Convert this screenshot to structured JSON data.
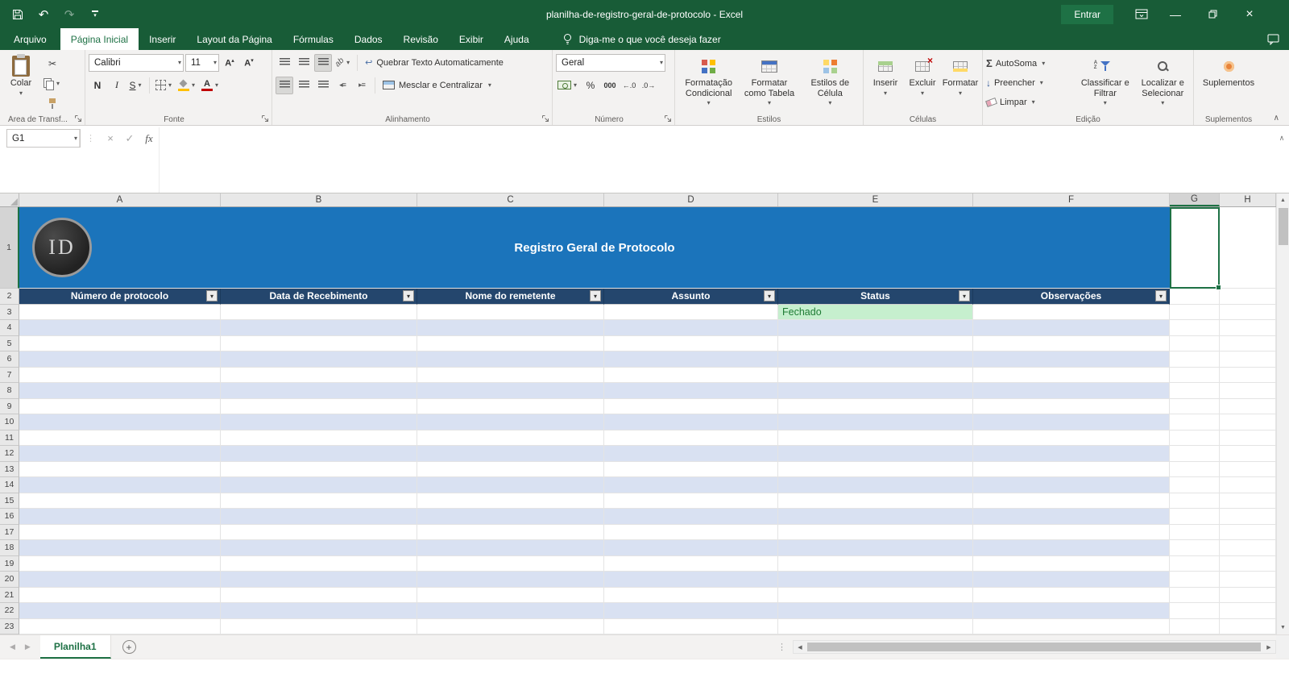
{
  "colors": {
    "excel_green": "#185C37",
    "accent_green": "#1E7145",
    "banner_blue": "#1B74BB",
    "table_header_blue": "#24466D",
    "band_blue": "#D9E1F2",
    "status_bg": "#C6EFCE",
    "status_text": "#1E7B34"
  },
  "titlebar": {
    "title": "planilha-de-registro-geral-de-protocolo - Excel",
    "signin": "Entrar"
  },
  "ribbon_tabs": {
    "file": "Arquivo",
    "tabs": [
      "Página Inicial",
      "Inserir",
      "Layout da Página",
      "Fórmulas",
      "Dados",
      "Revisão",
      "Exibir",
      "Ajuda"
    ],
    "tellme": "Diga-me o que você deseja fazer"
  },
  "ribbon": {
    "clipboard": {
      "paste": "Colar",
      "label": "Área de Transf..."
    },
    "font": {
      "name": "Calibri",
      "size": "11",
      "bold": "N",
      "italic": "I",
      "underline": "S",
      "label": "Fonte"
    },
    "alignment": {
      "wrap": "Quebrar Texto Automaticamente",
      "merge": "Mesclar e Centralizar",
      "label": "Alinhamento"
    },
    "number": {
      "format": "Geral",
      "percent": "%",
      "thousands": "000",
      "label": "Número"
    },
    "styles": {
      "conditional": "Formatação Condicional",
      "table": "Formatar como Tabela",
      "cell": "Estilos de Célula",
      "label": "Estilos"
    },
    "cells": {
      "insert": "Inserir",
      "delete": "Excluir",
      "format": "Formatar",
      "label": "Células"
    },
    "editing": {
      "autosum": "AutoSoma",
      "fill": "Preencher",
      "clear": "Limpar",
      "sort": "Classificar e Filtrar",
      "find": "Localizar e Selecionar",
      "label": "Edição"
    },
    "addins": {
      "button": "Suplementos",
      "label": "Suplementos"
    }
  },
  "formula_bar": {
    "name_box": "G1",
    "fx": "fx",
    "value": ""
  },
  "sheet": {
    "column_letters": [
      "A",
      "B",
      "C",
      "D",
      "E",
      "F",
      "G",
      "H"
    ],
    "row_numbers": [
      1,
      2,
      3,
      4,
      5,
      6,
      7,
      8,
      9,
      10,
      11,
      12,
      13,
      14,
      15,
      16,
      17,
      18,
      19,
      20,
      21,
      22,
      23
    ],
    "selected_cell": "G1",
    "banner_title": "Registro Geral de Protocolo",
    "logo_text": "ID",
    "table_headers": [
      "Número de protocolo",
      "Data de Recebimento",
      "Nome do remetente",
      "Assunto",
      "Status",
      "Observações"
    ],
    "status_cell": {
      "cell": "E3",
      "text": "Fechado"
    }
  },
  "sheet_tabs": {
    "active": "Planilha1"
  }
}
